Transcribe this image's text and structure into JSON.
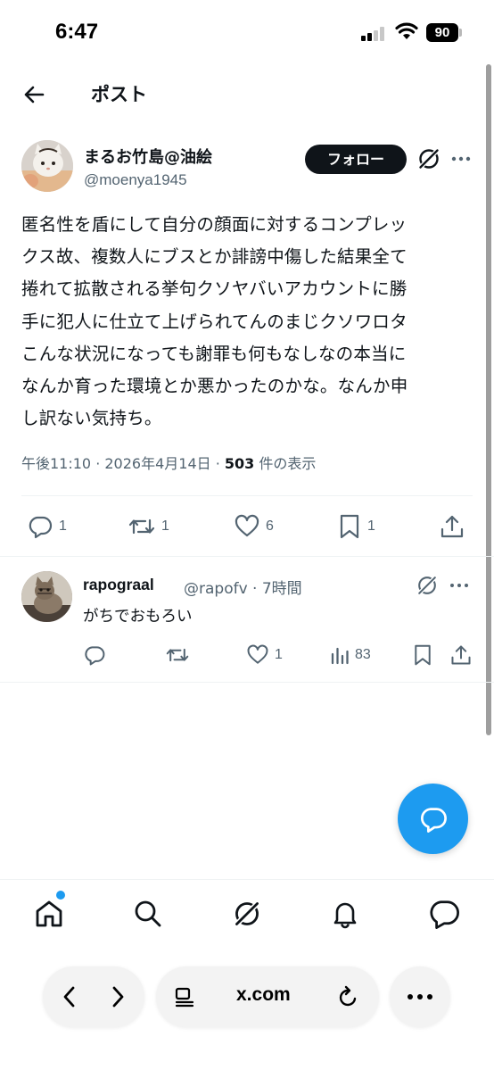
{
  "status_bar": {
    "time": "6:47",
    "battery": "90"
  },
  "header": {
    "title": "ポスト"
  },
  "post": {
    "author_name": "まるお竹島@油絵",
    "author_handle": "@moenya1945",
    "follow_label": "フォロー",
    "text_lines": [
      "匿名性を盾にして自分の顔面に対するコンプレッ",
      "クス故、複数人にブスとか誹謗中傷した結果全て",
      "捲れて拡散される挙句クソヤバいアカウントに勝",
      "手に犯人に仕立て上げられてんのまじクソワロタ",
      "こんな状況になっても謝罪も何もなしなの本当に",
      "なんか育った環境とか悪かったのかな。なんか申",
      "し訳ない気持ち。"
    ],
    "meta_time": "午後11:10 · 2026年4月14日 · ",
    "meta_views": "503",
    "meta_views_suffix": " 件の表示",
    "counts": {
      "replies": "1",
      "reposts": "1",
      "likes": "6",
      "bookmarks": "1"
    }
  },
  "reply": {
    "name": "rapograal",
    "handle_time": "@rapofv · 7時間",
    "text": "がちでおもろい",
    "counts": {
      "likes": "1",
      "views": "83"
    }
  },
  "bottom_nav": {
    "items": [
      "home-icon",
      "search-icon",
      "grok-icon",
      "notifications-icon",
      "messages-icon"
    ]
  },
  "browser": {
    "url": "x.com"
  },
  "colors": {
    "accent": "#1d9bf0",
    "text": "#0f1419",
    "secondary": "#536471"
  }
}
